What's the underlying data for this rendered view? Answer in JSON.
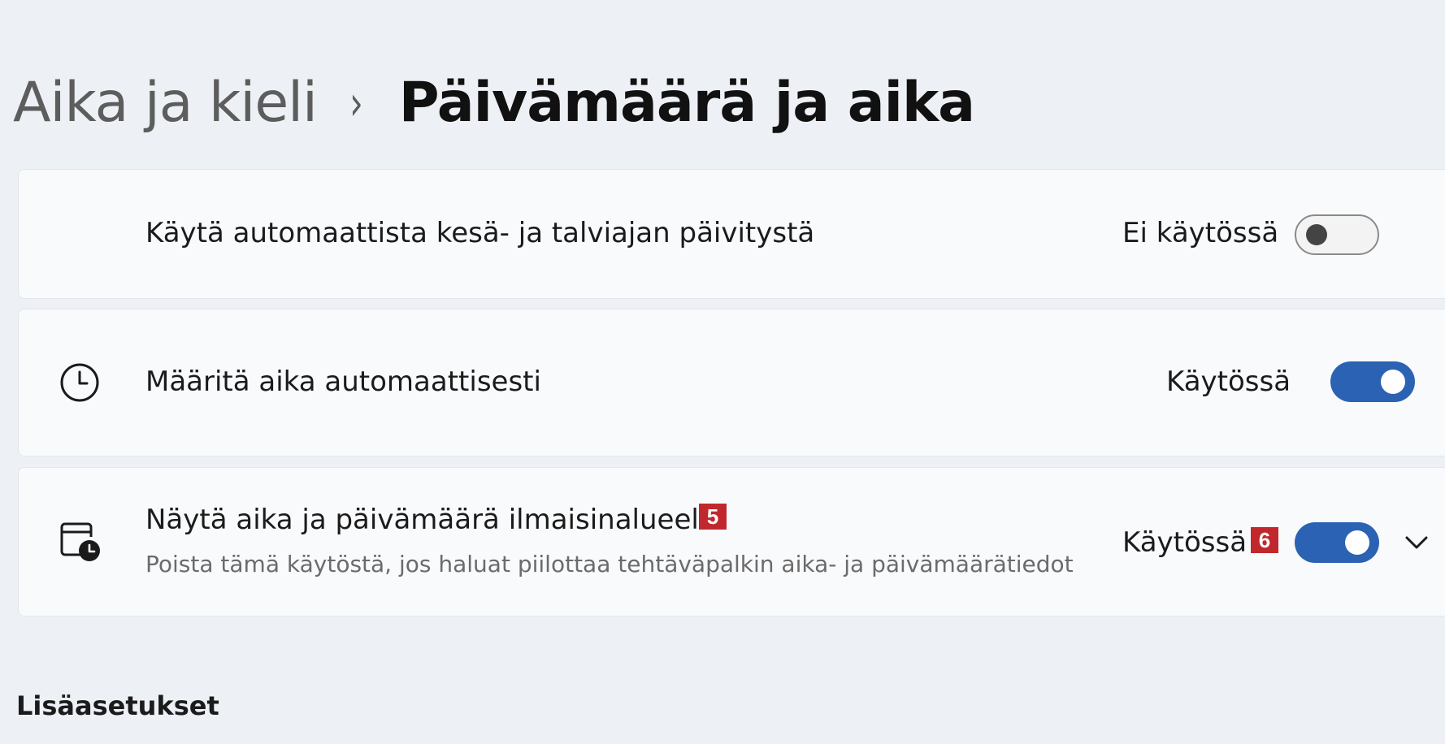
{
  "breadcrumb": {
    "parent": "Aika ja kieli",
    "separator": "›",
    "current": "Päivämäärä ja aika"
  },
  "rows": {
    "dst": {
      "title": "Käytä automaattista kesä- ja talviajan päivitystä",
      "state_label": "Ei käytössä",
      "toggle_on": false
    },
    "auto_time": {
      "icon": "clock-icon",
      "title": "Määritä aika automaattisesti",
      "state_label": "Käytössä",
      "toggle_on": true
    },
    "show_tray_time": {
      "icon": "calendar-clock-icon",
      "title": "Näytä aika ja päivämäärä ilmaisinalueella",
      "subtitle": "Poista tämä käytöstä, jos haluat piilottaa tehtäväpalkin aika- ja päivämäärätiedot",
      "title_badge": "5",
      "state_label": "Käytössä",
      "state_badge": "6",
      "toggle_on": true
    }
  },
  "sections": {
    "additional_title": "Lisäasetukset"
  },
  "colors": {
    "accent": "#2b62b3",
    "badge": "#c0282d",
    "background": "#edf1f5",
    "card": "#f9fafc"
  }
}
